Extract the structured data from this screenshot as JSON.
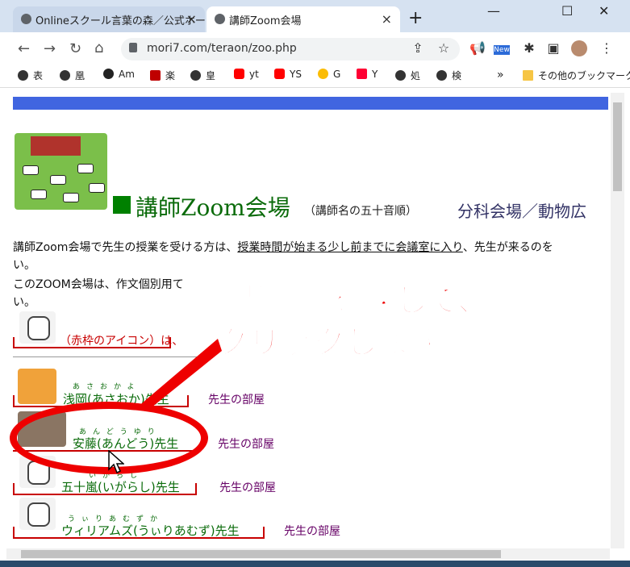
{
  "browser": {
    "tabs": [
      {
        "title": "Onlineスクール言葉の森／公式ホーム",
        "close": "×"
      },
      {
        "title": "講師Zoom会場",
        "close": "×"
      }
    ],
    "new_tab": "+",
    "window_controls": [
      "—",
      "☐",
      "✕"
    ],
    "url": "mori7.com/teraon/zoo.php",
    "bookmarks": [
      "表",
      "凰",
      "Am",
      "楽",
      "皇",
      "yt",
      "YS",
      "G",
      "Y",
      "処",
      "検"
    ],
    "bookmarks_more": "»",
    "other_bookmarks": "その他のブックマーク",
    "new_badge": "New"
  },
  "page": {
    "heading": "講師Zoom会場",
    "heading_note": "（講師名の五十音順）",
    "sub_venue": "分科会場／動物広",
    "intro_line1": "講師Zoom会場で先生の授業を受ける方は、",
    "intro_link": "授業時間が始まる少し前までに会議室に入り",
    "intro_line1_end": "、先生が来るのを",
    "intro_line2": "い。",
    "intro_line3": "このZOOM会場は、作文個別用て",
    "intro_line4": "い。",
    "icon_note_red": "赤枠",
    "icon_note": "（赤枠のアイコン）は、",
    "room_label": "先生の部屋",
    "teachers": [
      {
        "name": "浅岡(あさおか)先生",
        "furigana": "あさおかよ"
      },
      {
        "name": "安藤(あんどう)先生",
        "furigana": "あんどうゆり"
      },
      {
        "name": "五十嵐(いがらし)先生",
        "furigana": "いがらし"
      },
      {
        "name": "ウィリアムズ(うぃりあむず)先生",
        "furigana": "うぃりあむずか"
      }
    ]
  },
  "annotation": {
    "line1": "担当講師を探して、",
    "line2": "クリックします。"
  },
  "colors": {
    "accent_red": "#ee0000",
    "teacher_green": "#0a6b0a",
    "link_purple": "#660066",
    "banner_blue": "#4065e0"
  }
}
